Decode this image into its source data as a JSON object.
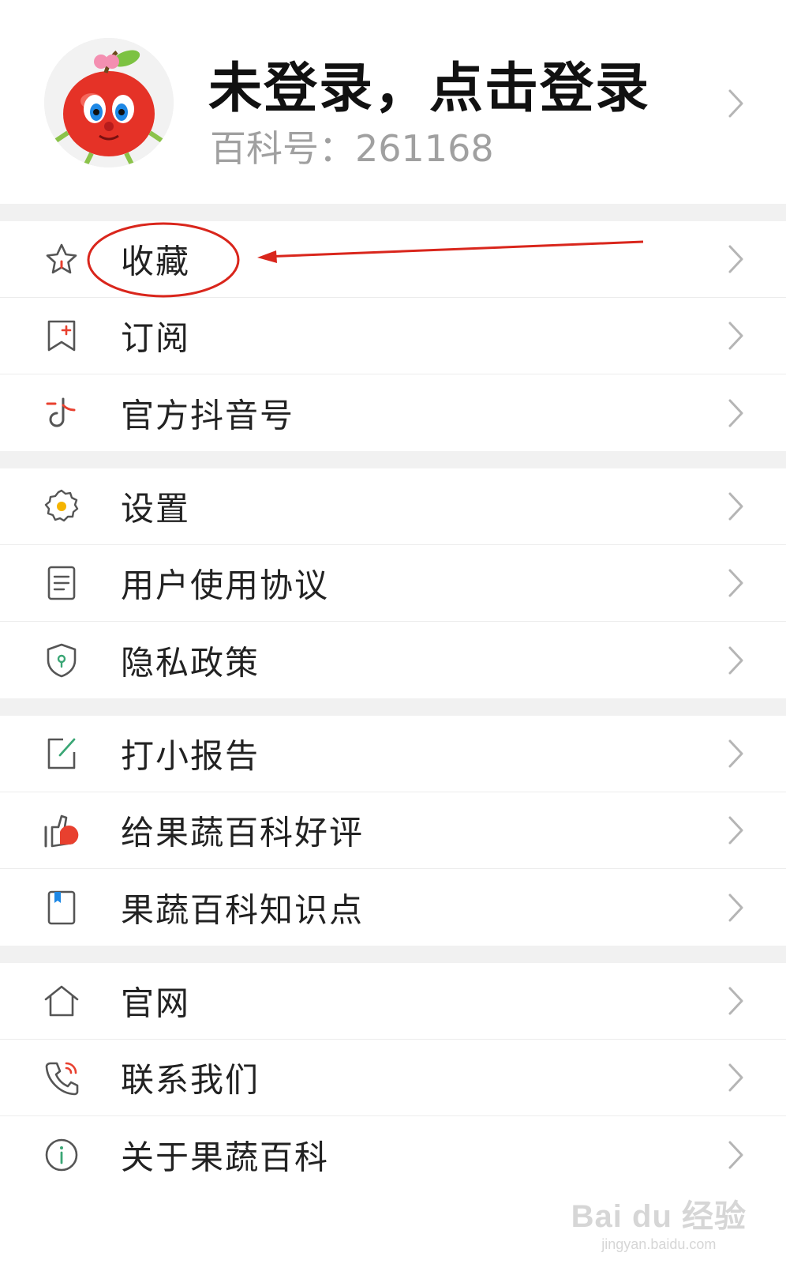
{
  "profile": {
    "title": "未登录，点击登录",
    "id_text": "百科号：261168",
    "avatar_icon": "apple-mascot-avatar"
  },
  "groups": [
    [
      {
        "label": "收藏",
        "icon": "star-icon"
      },
      {
        "label": "订阅",
        "icon": "bookmark-add-icon"
      },
      {
        "label": "官方抖音号",
        "icon": "douyin-icon"
      }
    ],
    [
      {
        "label": "设置",
        "icon": "gear-icon"
      },
      {
        "label": "用户使用协议",
        "icon": "document-icon"
      },
      {
        "label": "隐私政策",
        "icon": "shield-icon"
      }
    ],
    [
      {
        "label": "打小报告",
        "icon": "edit-icon"
      },
      {
        "label": "给果蔬百科好评",
        "icon": "thumbs-up-icon"
      },
      {
        "label": "果蔬百科知识点",
        "icon": "book-icon"
      }
    ],
    [
      {
        "label": "官网",
        "icon": "home-icon"
      },
      {
        "label": "联系我们",
        "icon": "phone-icon"
      },
      {
        "label": "关于果蔬百科",
        "icon": "info-icon"
      }
    ]
  ],
  "annotation": {
    "highlighted_item": "收藏",
    "color": "#d9261c"
  },
  "colors": {
    "accent_red": "#e8402f",
    "accent_yellow": "#f5b400",
    "icon_gray": "#555555"
  },
  "watermark": {
    "main": "Bai du 经验",
    "sub": "jingyan.baidu.com"
  }
}
